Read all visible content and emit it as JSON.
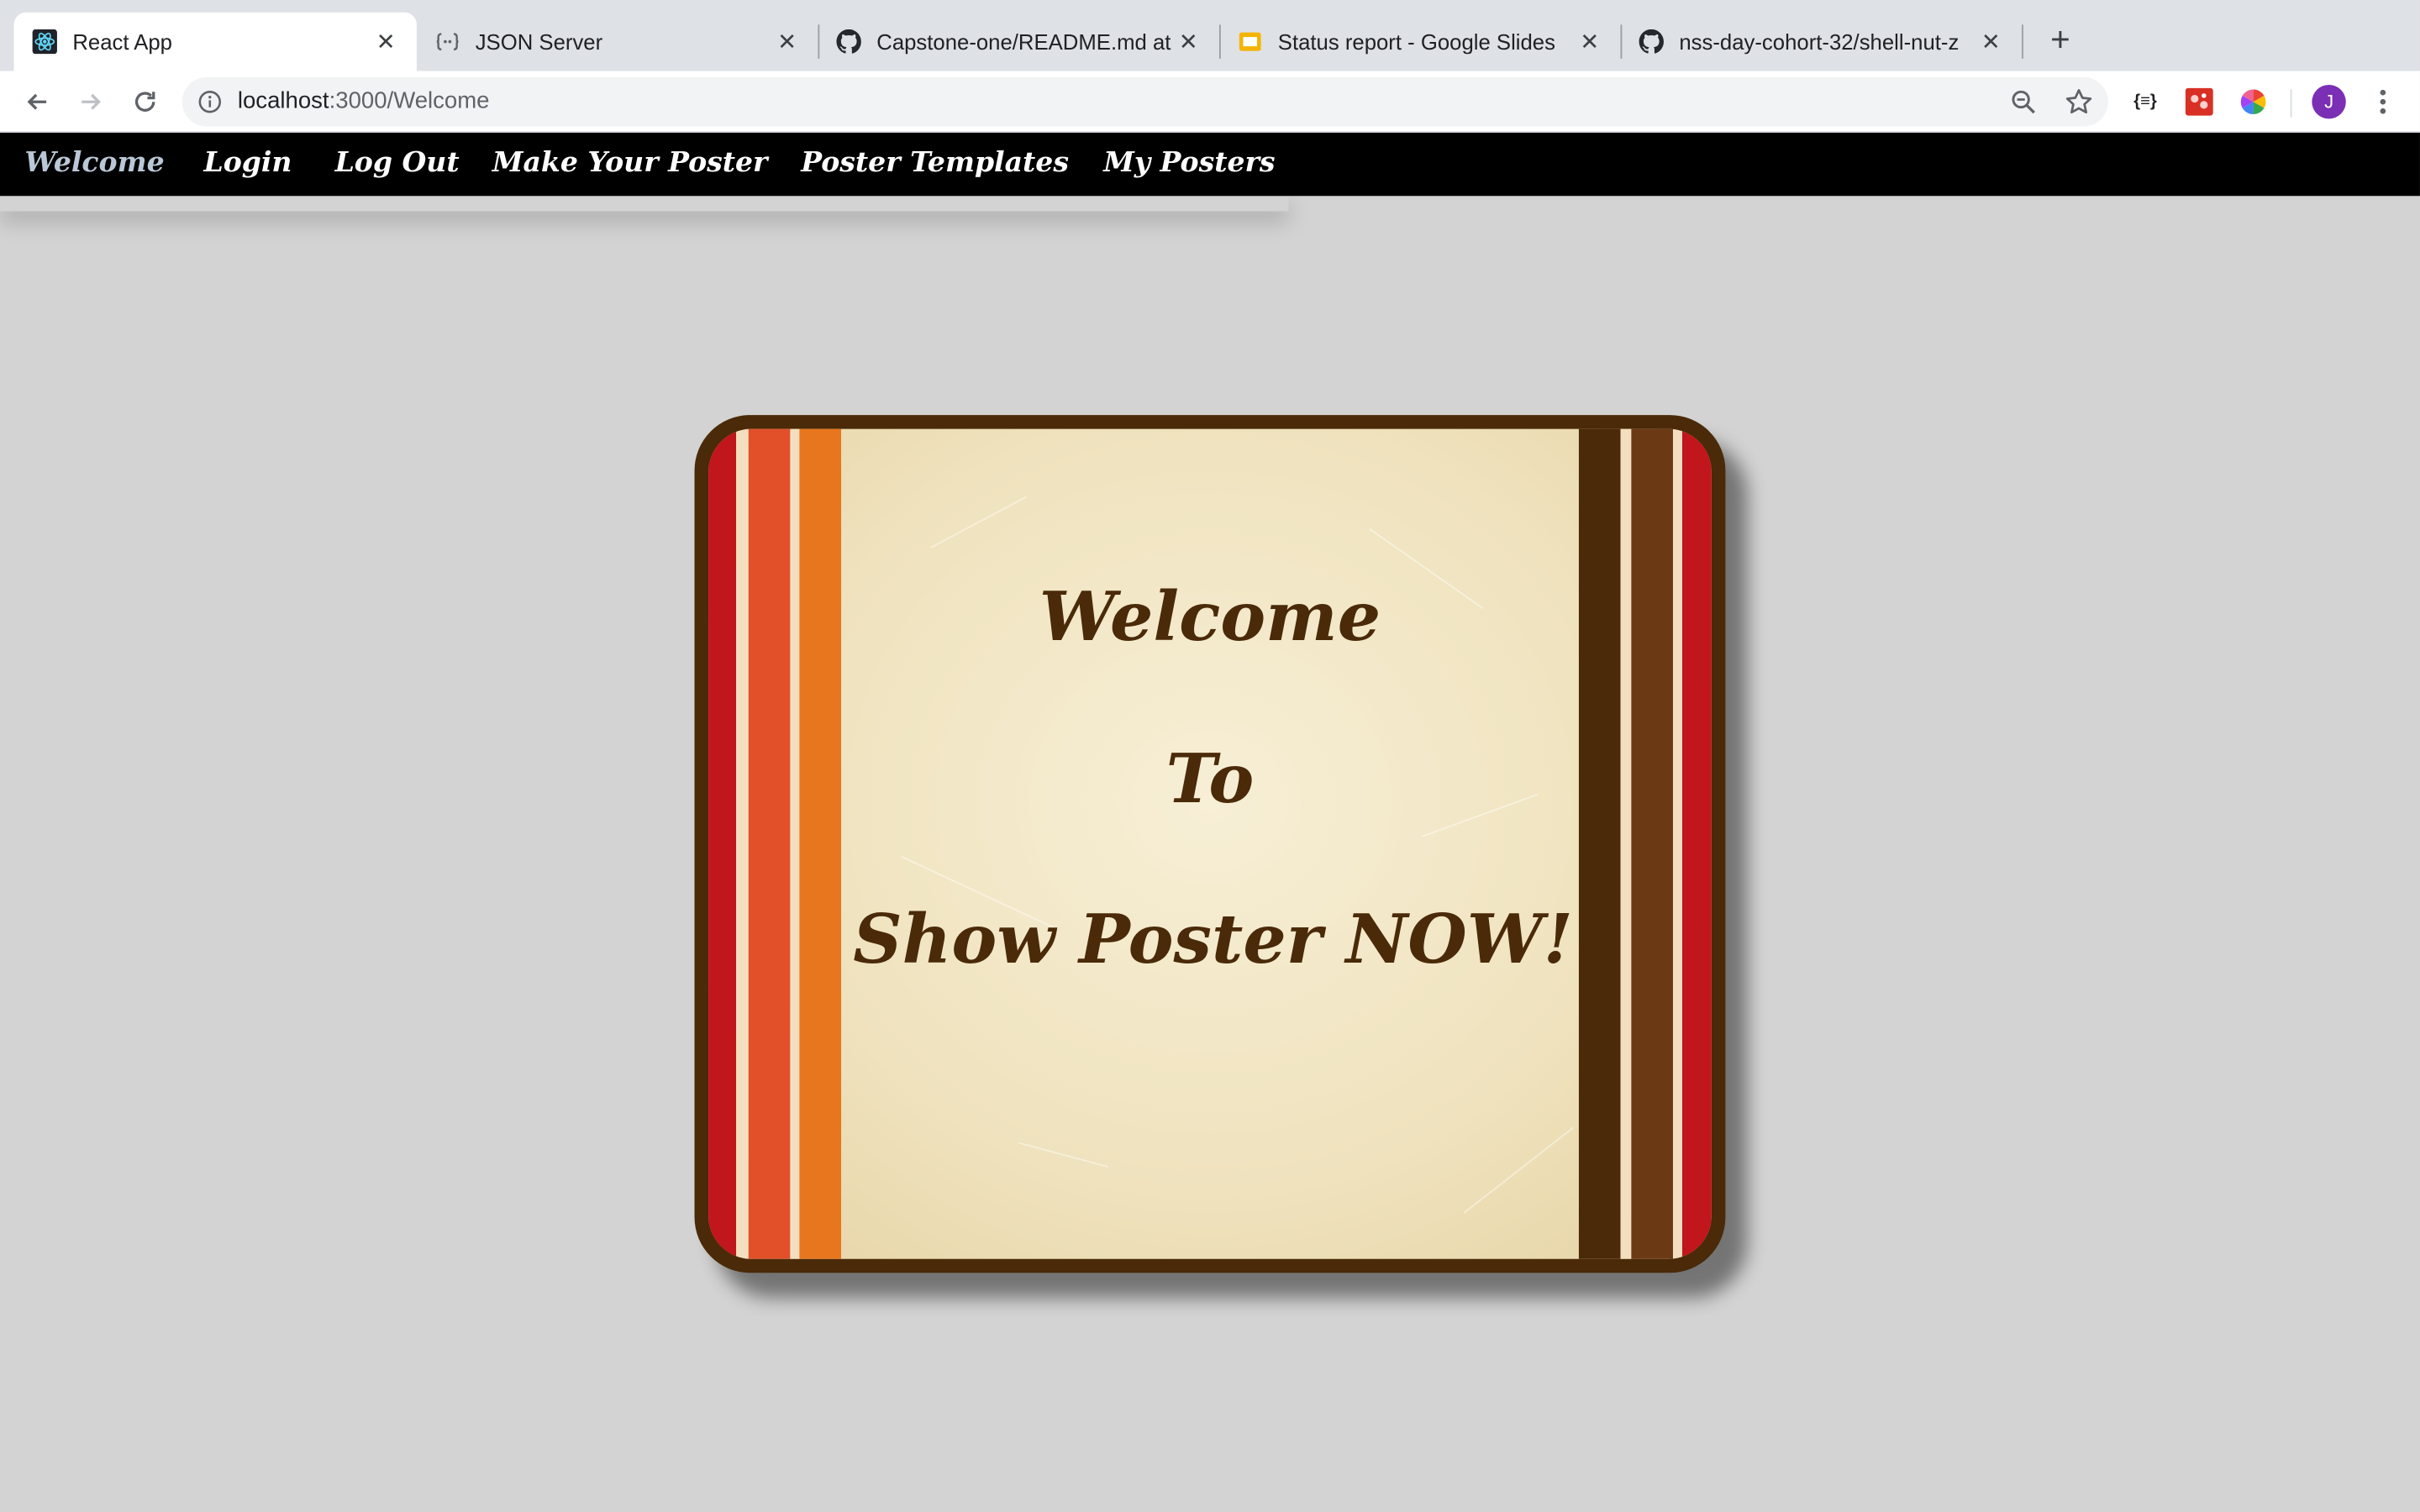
{
  "browser": {
    "tabs": [
      {
        "title": "React App",
        "icon": "react-icon",
        "active": true
      },
      {
        "title": "JSON Server",
        "icon": "json-server-icon",
        "active": false
      },
      {
        "title": "Capstone-one/README.md at",
        "icon": "github-icon",
        "active": false
      },
      {
        "title": "Status report - Google Slides",
        "icon": "slides-icon",
        "active": false
      },
      {
        "title": "nss-day-cohort-32/shell-nut-z",
        "icon": "github-icon",
        "active": false
      }
    ],
    "url_host": "localhost",
    "url_path": ":3000/Welcome",
    "avatar_initial": "J",
    "icons": [
      "back-icon",
      "forward-icon",
      "reload-icon",
      "info-icon",
      "zoom-icon",
      "star-icon",
      "json-ext-icon",
      "ext-red-icon",
      "color-wheel-icon",
      "menu-icon"
    ]
  },
  "nav": {
    "items": [
      "Welcome",
      "Login",
      "Log Out",
      "Make Your Poster",
      "Poster Templates",
      "My Posters"
    ],
    "current": "Welcome"
  },
  "poster": {
    "line1": "Welcome",
    "line2": "To",
    "line3": "Show Poster NOW!"
  },
  "colors": {
    "nav_bg": "#000000",
    "page_bg": "#d3d3d3",
    "poster_border": "#4a2a08",
    "poster_text": "#4a2a08",
    "stripe_red": "#c0161c",
    "stripe_orange_red": "#e2502a",
    "stripe_orange": "#e8761e",
    "stripe_dark_brown": "#4a2a08",
    "stripe_brown": "#6b3a14"
  }
}
